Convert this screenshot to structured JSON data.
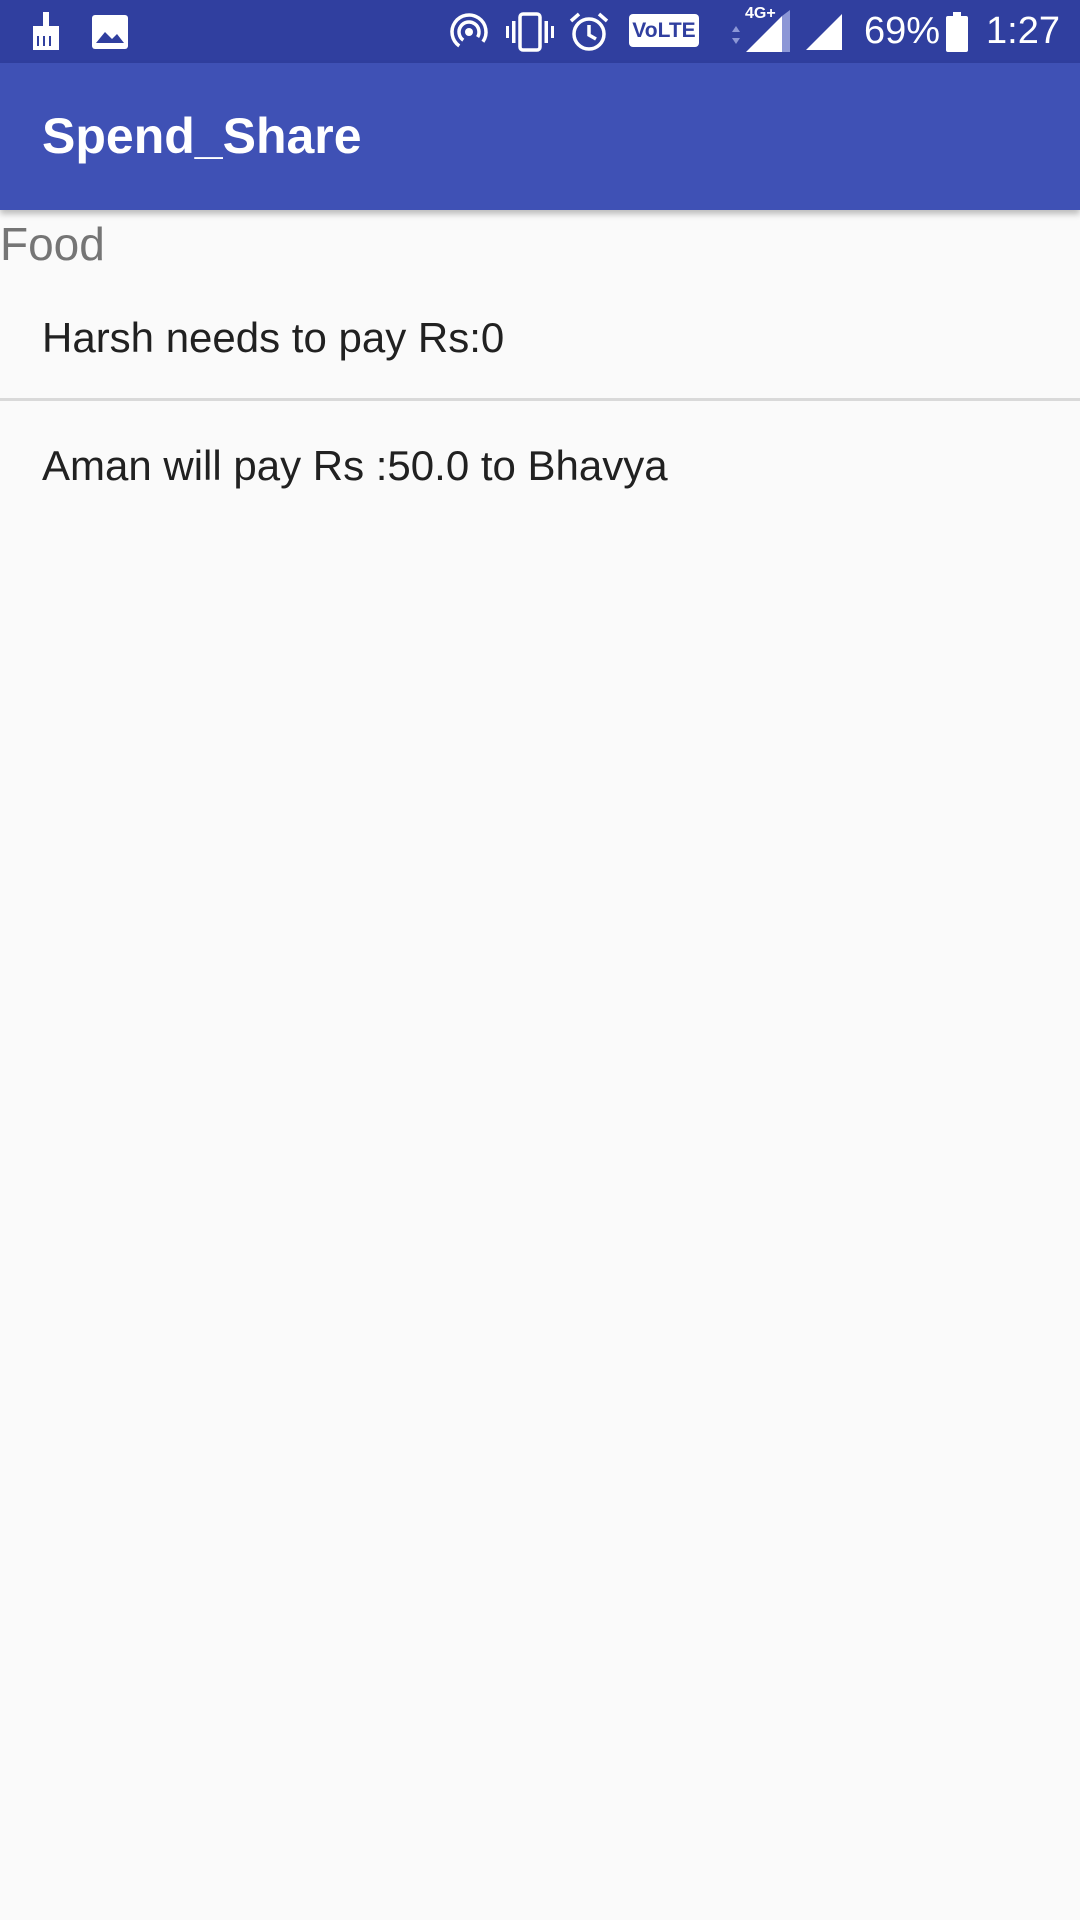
{
  "status_bar": {
    "icons_left": [
      "cleaner-icon",
      "image-icon"
    ],
    "icons_right": [
      "hotspot-icon",
      "vibrate-icon",
      "alarm-icon",
      "volte-icon",
      "signal-4g-icon",
      "signal-icon",
      "battery-icon"
    ],
    "volte_label": "VoLTE",
    "network_label": "4G+",
    "battery_percent": "69%",
    "time": "1:27"
  },
  "toolbar": {
    "title": "Spend_Share"
  },
  "category": {
    "label": "Food"
  },
  "items": [
    {
      "text": "Harsh needs to pay Rs:0"
    },
    {
      "text": "Aman will pay Rs :50.0 to Bhavya"
    }
  ],
  "colors": {
    "status_bar": "#303f9f",
    "toolbar": "#3f51b5",
    "background": "#fafafa",
    "primary_text": "#212121",
    "secondary_text": "#757575",
    "divider": "#d9d9d9"
  }
}
